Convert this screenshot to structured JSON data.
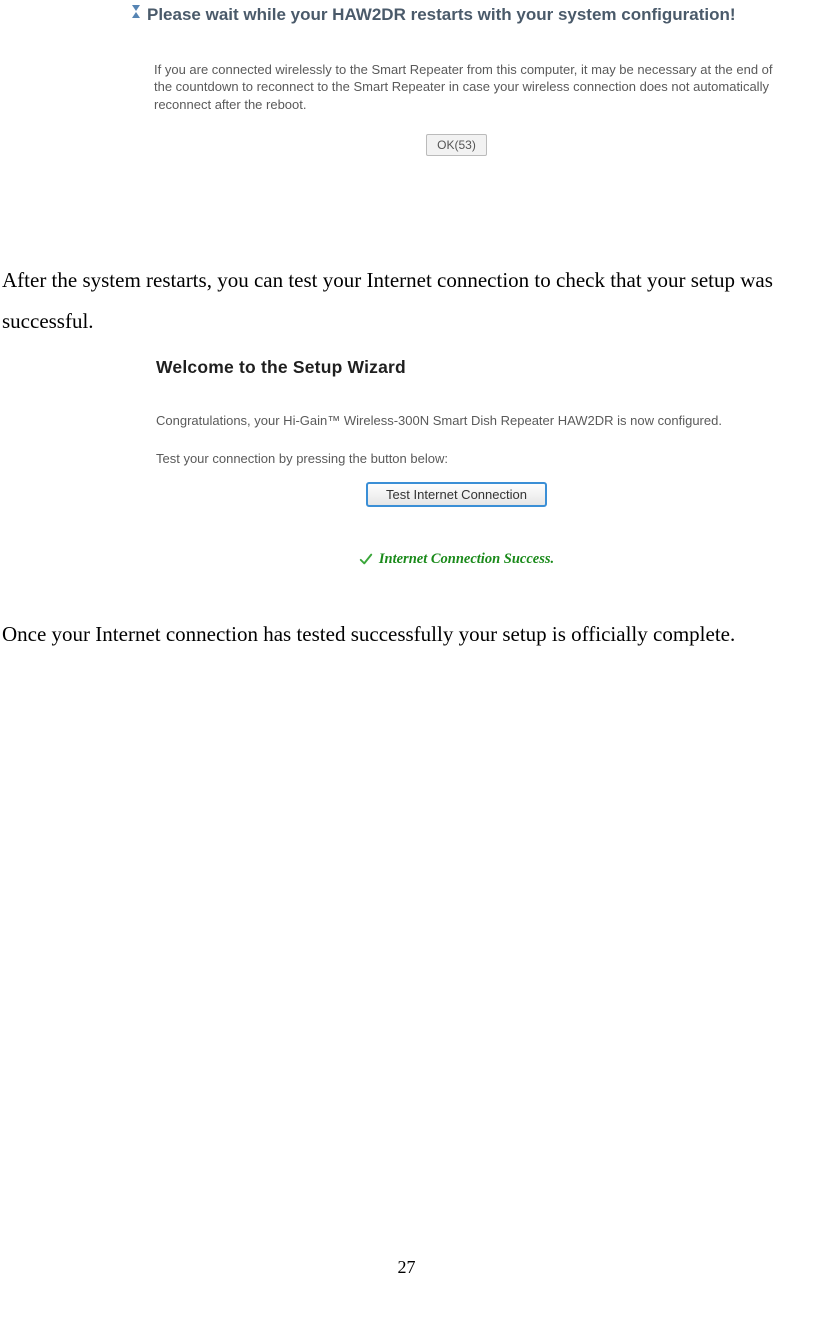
{
  "restartDialog": {
    "heading": "Please wait while your HAW2DR restarts with your system configuration!",
    "description": "If you are connected wirelessly to the Smart Repeater from this computer, it may be necessary at the end of the countdown to reconnect to the Smart Repeater in case your wireless connection does not automatically reconnect after the reboot.",
    "okButton": "OK(53)"
  },
  "para1": "After the system restarts, you can test your Internet connection to check that your setup was successful.",
  "wizard": {
    "heading": "Welcome to the Setup Wizard",
    "congrats": "Congratulations, your Hi-Gain™ Wireless-300N Smart Dish Repeater HAW2DR is now configured.",
    "testLabel": "Test your connection by pressing the button below:",
    "testButton": "Test Internet Connection",
    "successText": "Internet Connection Success."
  },
  "para2": "Once your Internet connection has tested successfully your setup is officially complete.",
  "pageNumber": "27"
}
